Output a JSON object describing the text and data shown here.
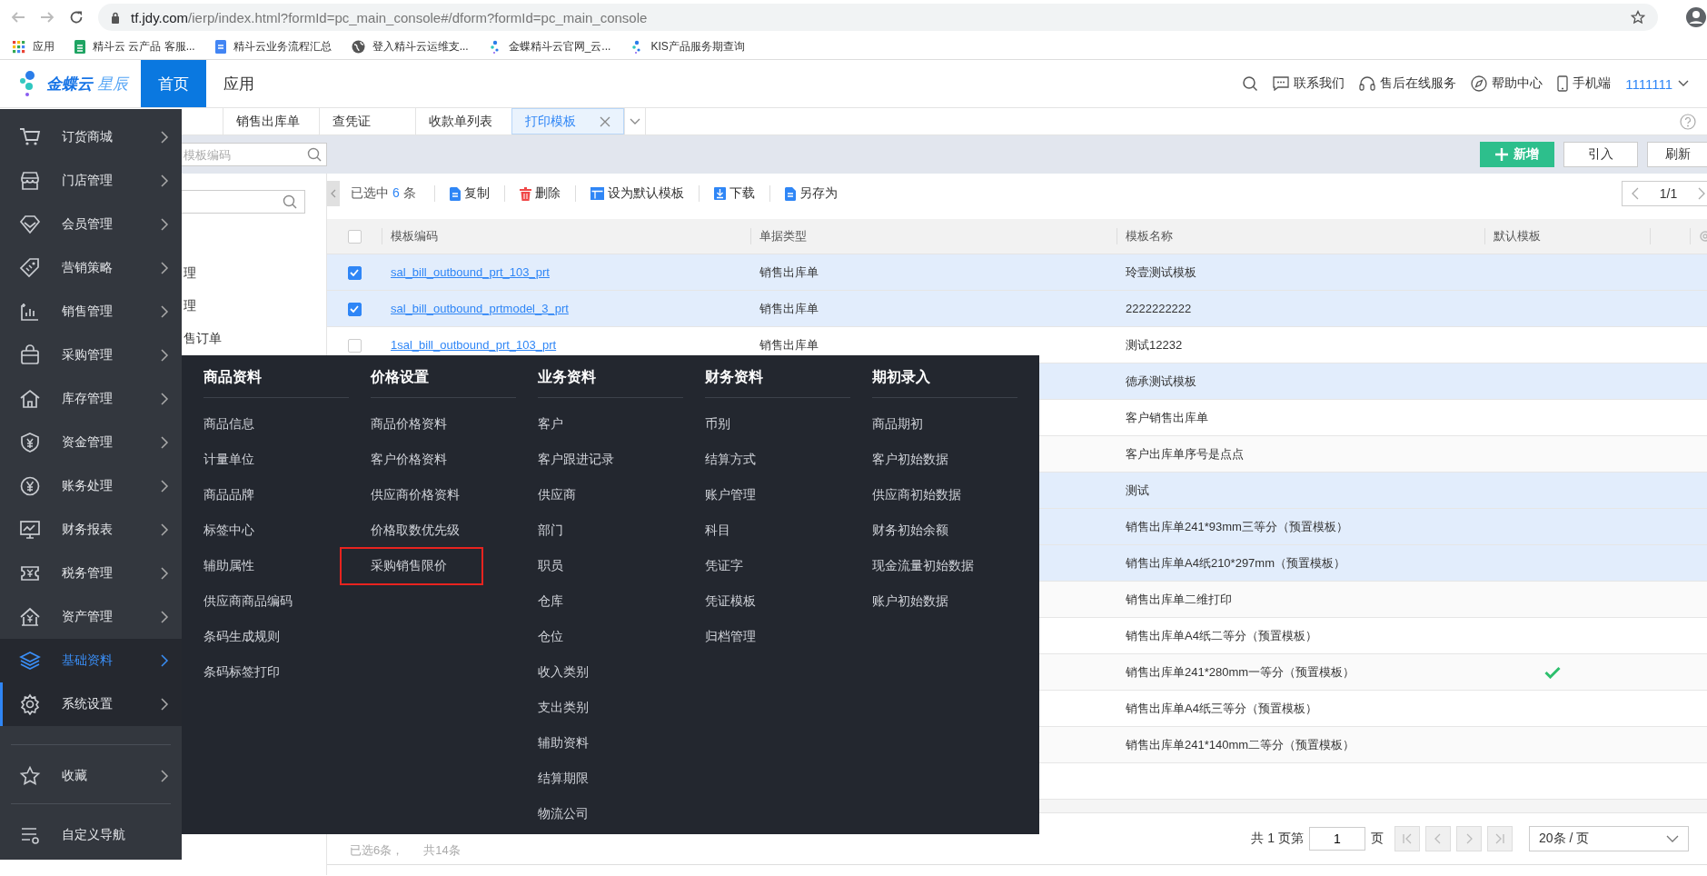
{
  "browser": {
    "url_host": "tf.jdy.com",
    "url_path": "/ierp/index.html?formId=pc_main_console#/dform?formId=pc_main_console",
    "bookmarks": [
      {
        "label": "应用",
        "kind": "apps"
      },
      {
        "label": "精斗云 云产品 客服...",
        "kind": "sheet"
      },
      {
        "label": "精斗云业务流程汇总",
        "kind": "doc"
      },
      {
        "label": "登入精斗云运维支...",
        "kind": "globe"
      },
      {
        "label": "金蝶精斗云官网_云...",
        "kind": "dots"
      },
      {
        "label": "KIS产品服务期查询",
        "kind": "dots"
      }
    ]
  },
  "header": {
    "logo_main": "金蝶云",
    "logo_sub": "星辰",
    "nav": [
      {
        "label": "首页",
        "selected": true
      },
      {
        "label": "应用",
        "selected": false
      }
    ],
    "links": [
      {
        "label": "联系我们"
      },
      {
        "label": "售后在线服务"
      },
      {
        "label": "帮助中心"
      },
      {
        "label": "手机端"
      }
    ],
    "user": "1111111"
  },
  "tabs": [
    {
      "label": "销售出库单",
      "selected": false
    },
    {
      "label": "查凭证",
      "selected": false
    },
    {
      "label": "收款单列表",
      "selected": false
    },
    {
      "label": "打印模板",
      "selected": true
    }
  ],
  "band": {
    "search_placeholder": "模板编码",
    "actions": [
      {
        "label": "新增",
        "kind": "primary"
      },
      {
        "label": "引入",
        "kind": "default"
      },
      {
        "label": "刷新",
        "kind": "default"
      }
    ]
  },
  "tree": {
    "items": [
      "理",
      "理",
      "售订单"
    ]
  },
  "toolbar": {
    "selected_prefix": "已选中",
    "selected_count": "6",
    "selected_suffix": "条",
    "buttons": [
      {
        "label": "复制",
        "kind": "copy"
      },
      {
        "label": "删除",
        "kind": "delete"
      },
      {
        "label": "设为默认模板",
        "kind": "default"
      },
      {
        "label": "下载",
        "kind": "download"
      },
      {
        "label": "另存为",
        "kind": "saveas"
      }
    ],
    "pager": "1/1"
  },
  "table": {
    "all_selected": false,
    "columns": [
      "模板编码",
      "单据类型",
      "模板名称",
      "默认模板"
    ],
    "rows": [
      {
        "selected": true,
        "code": "sal_bill_outbound_prt_103_prt",
        "type": "销售出库单",
        "name": "玲壹测试模板",
        "default": false
      },
      {
        "selected": true,
        "code": "sal_bill_outbound_prtmodel_3_prt",
        "type": "销售出库单",
        "name": "2222222222",
        "default": false
      },
      {
        "selected": false,
        "code": "1sal_bill_outbound_prt_103_prt",
        "type": "销售出库单",
        "name": "测试12232",
        "default": false
      },
      {
        "selected": true,
        "name": "德承测试模板",
        "default": false
      },
      {
        "selected": false,
        "name": "客户销售出库单",
        "default": false
      },
      {
        "selected": false,
        "name": "客户出库单序号是点点",
        "default": false
      },
      {
        "selected": true,
        "name": "测试",
        "default": false
      },
      {
        "selected": true,
        "name": "销售出库单241*93mm三等分（预置模板）",
        "default": false
      },
      {
        "selected": true,
        "name": "销售出库单A4纸210*297mm（预置模板）",
        "default": false
      },
      {
        "selected": false,
        "name": "销售出库单二维打印",
        "default": false
      },
      {
        "selected": false,
        "name": "销售出库单A4纸二等分（预置模板）",
        "default": false
      },
      {
        "selected": false,
        "name": "销售出库单241*280mm一等分（预置模板）",
        "default": true
      },
      {
        "selected": false,
        "name": "销售出库单A4纸三等分（预置模板）",
        "default": false
      },
      {
        "selected": false,
        "name": "销售出库单241*140mm二等分（预置模板）",
        "default": false
      }
    ]
  },
  "footer": {
    "selected_text": "已选6条，",
    "total_text": "共14条",
    "page_prefix": "共 1 页第",
    "page_value": "1",
    "page_suffix": "页",
    "page_size": "20条 / 页"
  },
  "sidebar": {
    "items": [
      {
        "label": "订货商城",
        "selected": false,
        "active": false
      },
      {
        "label": "门店管理",
        "selected": false,
        "active": false
      },
      {
        "label": "会员管理",
        "selected": false,
        "active": false
      },
      {
        "label": "营销策略",
        "selected": false,
        "active": false
      },
      {
        "label": "销售管理",
        "selected": false,
        "active": false
      },
      {
        "label": "采购管理",
        "selected": false,
        "active": false
      },
      {
        "label": "库存管理",
        "selected": false,
        "active": false
      },
      {
        "label": "资金管理",
        "selected": false,
        "active": false
      },
      {
        "label": "账务处理",
        "selected": false,
        "active": false
      },
      {
        "label": "财务报表",
        "selected": false,
        "active": false
      },
      {
        "label": "税务管理",
        "selected": false,
        "active": false
      },
      {
        "label": "资产管理",
        "selected": false,
        "active": false
      },
      {
        "label": "基础资料",
        "selected": true,
        "active": false
      },
      {
        "label": "系统设置",
        "selected": false,
        "active": true
      }
    ],
    "favorites": "收藏",
    "custom_nav": "自定义导航"
  },
  "menu": {
    "columns": [
      {
        "title": "商品资料",
        "items": [
          {
            "label": "商品信息",
            "highlighted": false
          },
          {
            "label": "计量单位",
            "highlighted": false
          },
          {
            "label": "商品品牌",
            "highlighted": false
          },
          {
            "label": "标签中心",
            "highlighted": false
          },
          {
            "label": "辅助属性",
            "highlighted": false
          },
          {
            "label": "供应商商品编码",
            "highlighted": false
          },
          {
            "label": "条码生成规则",
            "highlighted": false
          },
          {
            "label": "条码标签打印",
            "highlighted": false
          }
        ]
      },
      {
        "title": "价格设置",
        "items": [
          {
            "label": "商品价格资料",
            "highlighted": false
          },
          {
            "label": "客户价格资料",
            "highlighted": false
          },
          {
            "label": "供应商价格资料",
            "highlighted": false
          },
          {
            "label": "价格取数优先级",
            "highlighted": false
          },
          {
            "label": "采购销售限价",
            "highlighted": true
          }
        ]
      },
      {
        "title": "业务资料",
        "items": [
          {
            "label": "客户",
            "highlighted": false
          },
          {
            "label": "客户跟进记录",
            "highlighted": false
          },
          {
            "label": "供应商",
            "highlighted": false
          },
          {
            "label": "部门",
            "highlighted": false
          },
          {
            "label": "职员",
            "highlighted": false
          },
          {
            "label": "仓库",
            "highlighted": false
          },
          {
            "label": "仓位",
            "highlighted": false
          },
          {
            "label": "收入类别",
            "highlighted": false
          },
          {
            "label": "支出类别",
            "highlighted": false
          },
          {
            "label": "辅助资料",
            "highlighted": false
          },
          {
            "label": "结算期限",
            "highlighted": false
          },
          {
            "label": "物流公司",
            "highlighted": false
          }
        ]
      },
      {
        "title": "财务资料",
        "items": [
          {
            "label": "币别",
            "highlighted": false
          },
          {
            "label": "结算方式",
            "highlighted": false
          },
          {
            "label": "账户管理",
            "highlighted": false
          },
          {
            "label": "科目",
            "highlighted": false
          },
          {
            "label": "凭证字",
            "highlighted": false
          },
          {
            "label": "凭证模板",
            "highlighted": false
          },
          {
            "label": "归档管理",
            "highlighted": false
          }
        ]
      },
      {
        "title": "期初录入",
        "items": [
          {
            "label": "商品期初",
            "highlighted": false
          },
          {
            "label": "客户初始数据",
            "highlighted": false
          },
          {
            "label": "供应商初始数据",
            "highlighted": false
          },
          {
            "label": "财务初始余额",
            "highlighted": false
          },
          {
            "label": "现金流量初始数据",
            "highlighted": false
          },
          {
            "label": "账户初始数据",
            "highlighted": false
          }
        ]
      }
    ]
  }
}
